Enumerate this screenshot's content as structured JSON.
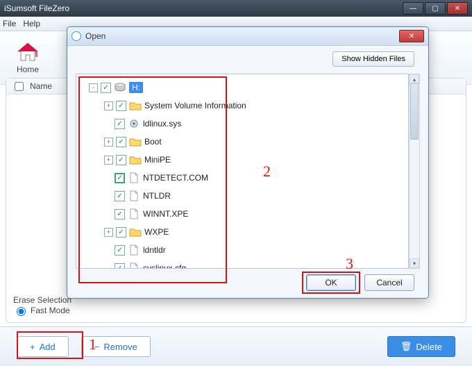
{
  "app": {
    "title": "iSumsoft FileZero"
  },
  "menu": {
    "file": "File",
    "help": "Help"
  },
  "toolbar": {
    "home": "Home"
  },
  "list": {
    "name_col_checkbox": false,
    "name_col": "Name"
  },
  "erase": {
    "label": "Erase Selection",
    "fast": "Fast Mode"
  },
  "bottom": {
    "add": "Add",
    "remove": "Remove",
    "delete": "Delete"
  },
  "dialog": {
    "title": "Open",
    "show_hidden": "Show Hidden Files",
    "ok": "OK",
    "cancel": "Cancel",
    "tree": [
      {
        "expand": "-",
        "checked": true,
        "kind": "drive",
        "label": "H:",
        "selected": true,
        "level": 1
      },
      {
        "expand": "+",
        "checked": true,
        "kind": "folder",
        "label": "System Volume Information",
        "level": 2
      },
      {
        "expand": "",
        "checked": true,
        "kind": "gear",
        "label": "ldlinux.sys",
        "level": 2
      },
      {
        "expand": "+",
        "checked": true,
        "kind": "folder",
        "label": "Boot",
        "level": 2
      },
      {
        "expand": "+",
        "checked": true,
        "kind": "folder",
        "label": "MiniPE",
        "level": 2
      },
      {
        "expand": "",
        "checked": true,
        "kind": "file",
        "label": "NTDETECT.COM",
        "level": 2,
        "box": true
      },
      {
        "expand": "",
        "checked": true,
        "kind": "file",
        "label": "NTLDR",
        "level": 2
      },
      {
        "expand": "",
        "checked": true,
        "kind": "file",
        "label": "WINNT.XPE",
        "level": 2
      },
      {
        "expand": "+",
        "checked": true,
        "kind": "folder",
        "label": "WXPE",
        "level": 2
      },
      {
        "expand": "",
        "checked": true,
        "kind": "file",
        "label": "ldntldr",
        "level": 2
      },
      {
        "expand": "",
        "checked": true,
        "kind": "file",
        "label": "syslinux.cfg",
        "level": 2
      }
    ]
  },
  "annotations": {
    "n1": "1",
    "n2": "2",
    "n3": "3"
  }
}
